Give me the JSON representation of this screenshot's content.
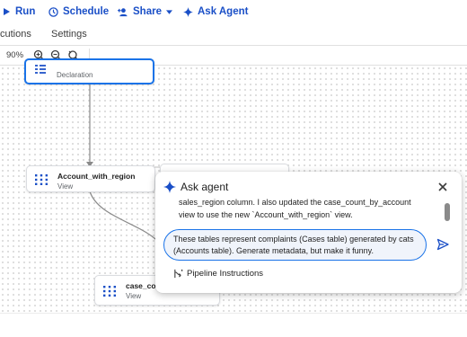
{
  "toolbar": {
    "run_label": "Run",
    "schedule_label": "Schedule",
    "share_label": "Share",
    "ask_agent_label": "Ask Agent"
  },
  "tabs": {
    "executions_label": "cutions",
    "settings_label": "Settings"
  },
  "zoom": {
    "level": "90%"
  },
  "nodes": {
    "declaration": {
      "title": "",
      "subtitle": "Declaration"
    },
    "account_with_region": {
      "title": "Account_with_region",
      "subtitle": "View"
    },
    "case_count": {
      "title": "case_cou",
      "subtitle": "View"
    }
  },
  "agent_panel": {
    "title": "Ask agent",
    "message_line1": "sales_region  column. I also updated the  case_count_by_account",
    "message_line2": "view to use the new `Account_with_region` view.",
    "input_value": "These tables represent complaints (Cases table) generated by cats (Accounts table). Generate metadata, but make it funny.",
    "pipeline_instructions_label": "Pipeline Instructions"
  },
  "colors": {
    "accent": "#1a4fc7",
    "selection": "#1a73e8",
    "node_icon": "#1a4fc7"
  },
  "icons": {
    "run": "play-icon",
    "schedule": "clock-icon",
    "share": "person-add-icon",
    "ask_agent": "sparkle-icon"
  }
}
